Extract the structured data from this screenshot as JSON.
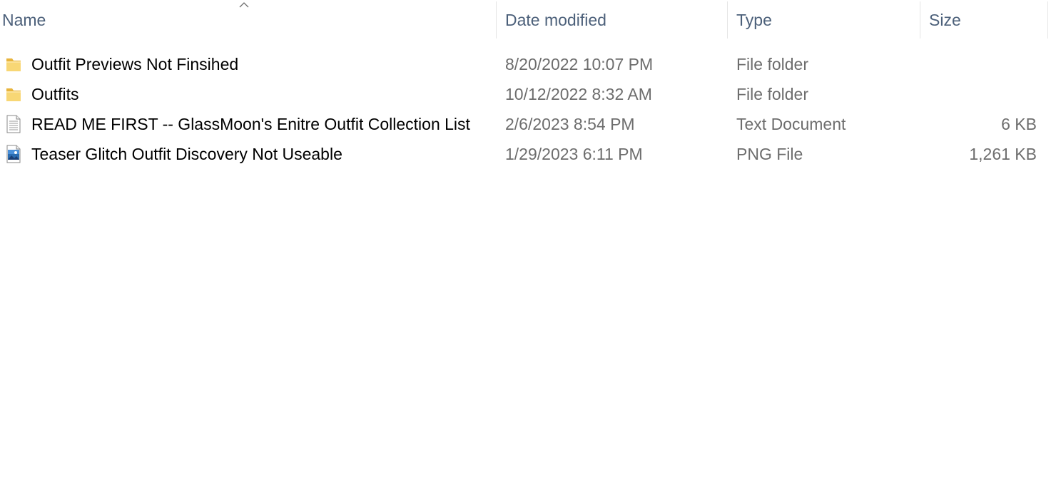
{
  "columns": {
    "name": "Name",
    "date_modified": "Date modified",
    "type": "Type",
    "size": "Size"
  },
  "sort": {
    "column": "name",
    "direction": "ascending",
    "icon": "chevron-up-icon"
  },
  "colors": {
    "header_text": "#4c607a",
    "name_text": "#000000",
    "meta_text": "#6d6d6d",
    "folder_yellow": "#f8d775",
    "hover_bg": "#e5f3ff"
  },
  "files": [
    {
      "name": "Outfit Previews Not Finsihed",
      "date": "8/20/2022 10:07 PM",
      "type": "File folder",
      "size": "",
      "icon": "folder-icon"
    },
    {
      "name": "Outfits",
      "date": "10/12/2022 8:32 AM",
      "type": "File folder",
      "size": "",
      "icon": "folder-icon"
    },
    {
      "name": "READ ME FIRST -- GlassMoon's Enitre Outfit Collection List",
      "date": "2/6/2023 8:54 PM",
      "type": "Text Document",
      "size": "6 KB",
      "icon": "text-document-icon"
    },
    {
      "name": "Teaser Glitch Outfit Discovery Not Useable",
      "date": "1/29/2023 6:11 PM",
      "type": "PNG File",
      "size": "1,261 KB",
      "icon": "image-file-icon"
    }
  ]
}
